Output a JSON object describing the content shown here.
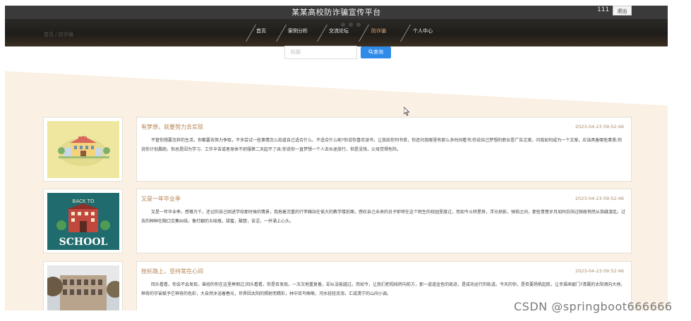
{
  "header": {
    "site_title": "某某高校防诈骗宣传平台",
    "user_name": "111",
    "logout_label": "退出",
    "ghost_crumb": "首页 / 防诈骗"
  },
  "nav": {
    "items": [
      {
        "label": "首页",
        "active": false
      },
      {
        "label": "案例分析",
        "active": false
      },
      {
        "label": "交流论坛",
        "active": false
      },
      {
        "label": "防诈骗",
        "active": true
      },
      {
        "label": "个人中心",
        "active": false
      }
    ]
  },
  "search": {
    "placeholder": "标题",
    "button_label": "查询"
  },
  "articles": [
    {
      "title": "有梦想，就要努力去实现",
      "date": "2023-04-23 09:52:46",
      "body": "不管你想要怎样的生活，你都要去努力争取，不多尝试一些事情怎么知道自己适合什么、不适合什么呢?你说你喜欢读书，让我给你列书单，你还问我哪里有那么多时间看书;你说自己梦想的职业是广告文案，问我如何成为一个文案，应该具备哪些素质;你说你计划晨跑，但总是因为学习、工作辛苦或者身体不舒服第二天起不了床;你说你一直梦想一个人去长途旅行，但是没钱，父母觉得危险。"
    },
    {
      "title": "又是一年毕业季",
      "date": "2023-04-23 09:52:46",
      "body": "又是一年毕业季，感慨万千，还记的自己刚进学校那时候的情景，我拖着沉重的行李箱站在偌大的教学楼前面，感叹自己未来的日子即将在这个陌生的校园里度过，而如今斗转星移，浮光掠影，弹指之间，那些青葱岁月如同白驹过隙般悄然从指缝溜走。过去的种种在胸口交集纠结，像打翻的五味瓶，甜蜜，酸楚，苦涩，一并涌上心头。"
    },
    {
      "title": "挫折路上，坚持常在心间",
      "date": "2023-04-23 09:52:46",
      "body": "回头看看，你会不会发现，曾经的你在这里摔倒过;回头看看，你是否发现，一次次地重复着，却从没能越过。而如今，让我们把视线转向前方，那一道道金色的斑迹，是成功运行的轨道。今天的你，是否要扬帆起航，让幸福来敲门?清晨的太阳洒向大地，神奇的宇宙赋予它神奇的色彩，大自然沐浴着春光，世界因太阳的照射而精彩，林中百鸟啾啾，河水轻轻流淌，汇成清宁的山间小调。"
    }
  ],
  "thumbs": [
    {
      "icon": "school-building-illustration"
    },
    {
      "icon": "back-to-school-poster",
      "line1": "BACK TO",
      "line2": "SCHOOL"
    },
    {
      "icon": "campus-building-photo"
    }
  ],
  "watermark": "CSDN @springboot666666",
  "colors": {
    "accent": "#b5834f",
    "search_button": "#2f8ae8",
    "beige_band": "#faf0e3",
    "header_dark": "#2c2a26"
  }
}
